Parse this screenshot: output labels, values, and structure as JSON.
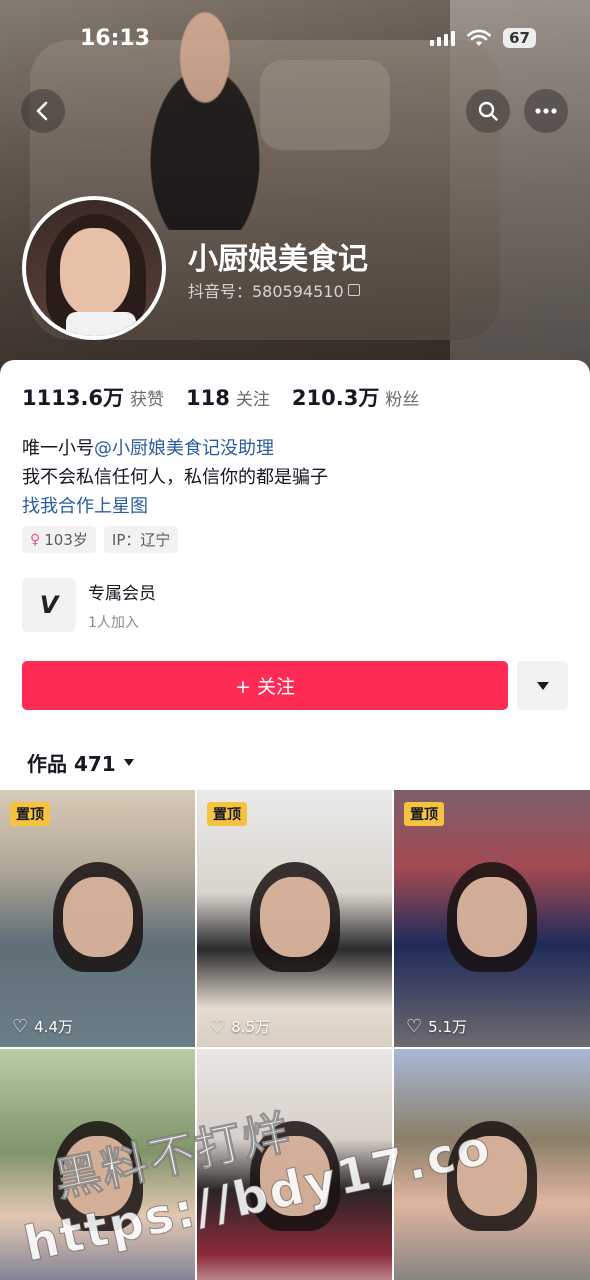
{
  "status_bar": {
    "time": "16:13",
    "battery": "67"
  },
  "profile": {
    "nickname": "小厨娘美食记",
    "douyin_id": "抖音号：580594510",
    "stats": [
      {
        "num": "1113.6万",
        "label": "获赞"
      },
      {
        "num": "118",
        "label": "关注"
      },
      {
        "num": "210.3万",
        "label": "粉丝"
      }
    ],
    "bio": {
      "line1_prefix": "唯一小号",
      "line1_mention": "@小厨娘美食记没助理",
      "line2": "我不会私信任何人，私信你的都是骗子",
      "line3_link": "找我合作上星图"
    },
    "tags": {
      "age": "103岁",
      "ip": "IP：辽宁"
    }
  },
  "member": {
    "logo": "V",
    "title": "专属会员",
    "subtitle": "1人加入"
  },
  "actions": {
    "follow_label": "+ 关注"
  },
  "works": {
    "tab_label": "作品 471"
  },
  "grid": [
    {
      "pinned": "置顶",
      "likes": "4.4万"
    },
    {
      "pinned": "置顶",
      "likes": "8.5万"
    },
    {
      "pinned": "置顶",
      "likes": "5.1万"
    },
    {
      "pinned": "",
      "likes": ""
    },
    {
      "pinned": "",
      "likes": ""
    },
    {
      "pinned": "",
      "likes": ""
    }
  ],
  "watermark": {
    "line1": "黑料不打烊",
    "line2": "https://bdy17.co"
  },
  "colors": {
    "accent": "#fe2c55",
    "link": "#2a5d9f",
    "pin": "#f5c242"
  }
}
